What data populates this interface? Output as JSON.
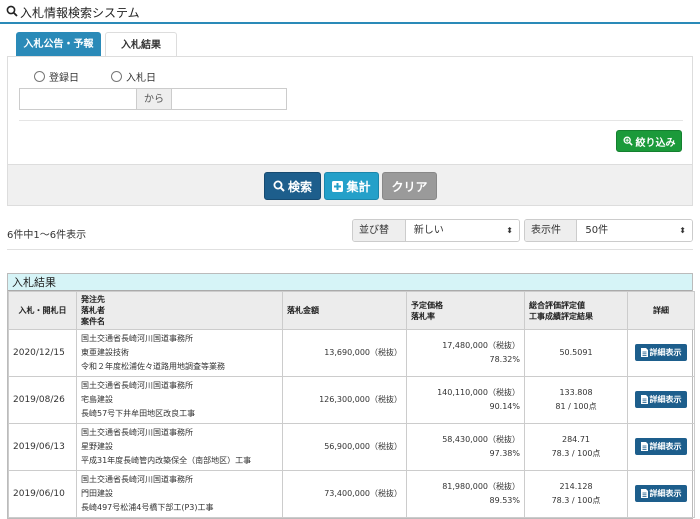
{
  "header": {
    "title": "入札情報検索システム"
  },
  "tabs": [
    {
      "label": "入札公告・予報"
    },
    {
      "label": "入札結果"
    }
  ],
  "form": {
    "radio_registered": "登録日",
    "radio_bid": "入札日",
    "date_separator": "から",
    "filter_button": "絞り込み"
  },
  "actions": {
    "search": "検索",
    "aggregate": "集計",
    "clear": "クリア"
  },
  "listing": {
    "count_text": "6件中1〜6件表示",
    "sort_label": "並び替え",
    "sort_value": "新しい",
    "per_page_label": "表示件数",
    "per_page_value": "50件"
  },
  "results": {
    "title": "入札結果",
    "columns": {
      "date": "入札・開札日",
      "info": [
        "発注先",
        "落札者",
        "案件名"
      ],
      "amount": "落札金額",
      "price": [
        "予定価格",
        "落札率"
      ],
      "eval": [
        "総合評価評定値",
        "工事成績評定結果"
      ],
      "detail": "詳細"
    },
    "detail_button": "詳細表示",
    "rows": [
      {
        "date": "2020/12/15",
        "orderer": "国土交通省長崎河川国道事務所",
        "winner": "東亜建設技術",
        "project": "令和２年度松浦佐々道路用地調査等業務",
        "amount": "13,690,000（税抜）",
        "planned": "17,480,000（税抜）",
        "rate": "78.32%",
        "eval_score": "50.5091",
        "eval_result": ""
      },
      {
        "date": "2019/08/26",
        "orderer": "国土交通省長崎河川国道事務所",
        "winner": "宅島建設",
        "project": "長崎57号下井牟田地区改良工事",
        "amount": "126,300,000（税抜）",
        "planned": "140,110,000（税抜）",
        "rate": "90.14%",
        "eval_score": "133.808",
        "eval_result": "81 / 100点"
      },
      {
        "date": "2019/06/13",
        "orderer": "国土交通省長崎河川国道事務所",
        "winner": "星野建設",
        "project": "平成31年度長崎管内改築保全（南部地区）工事",
        "amount": "56,900,000（税抜）",
        "planned": "58,430,000（税抜）",
        "rate": "97.38%",
        "eval_score": "284.71",
        "eval_result": "78.3 / 100点"
      },
      {
        "date": "2019/06/10",
        "orderer": "国土交通省長崎河川国道事務所",
        "winner": "門田建設",
        "project": "長崎497号松浦4号橋下部工(P3)工事",
        "amount": "73,400,000（税抜）",
        "planned": "81,980,000（税抜）",
        "rate": "89.53%",
        "eval_score": "214.128",
        "eval_result": "78.3 / 100点"
      }
    ]
  }
}
